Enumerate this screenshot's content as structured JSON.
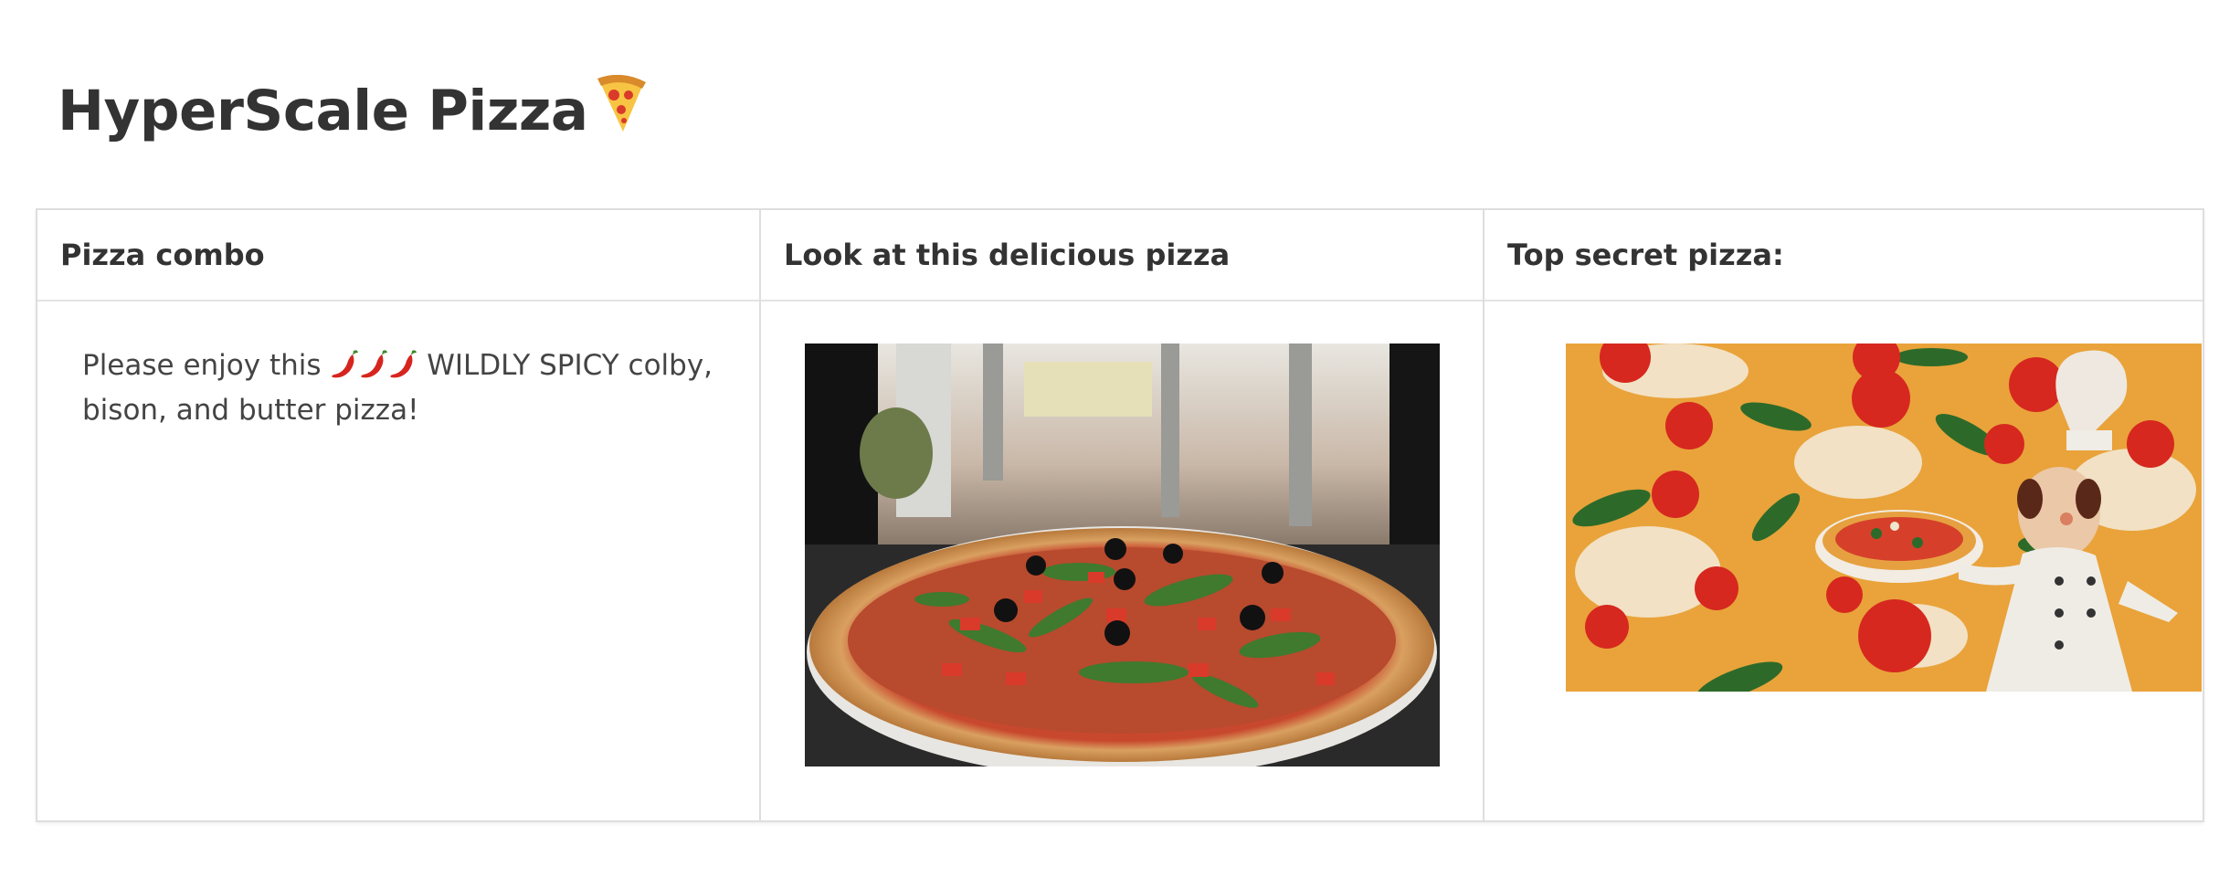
{
  "page": {
    "title": "HyperScale Pizza",
    "title_icon": "pizza-slice-icon"
  },
  "columns": [
    {
      "header": "Pizza combo",
      "text_before": "Please enjoy this",
      "text_icons": [
        "chili-pepper-icon",
        "chili-pepper-icon",
        "chili-pepper-icon"
      ],
      "text_after": "WILDLY SPICY colby, bison, and butter pizza!"
    },
    {
      "header": "Look at this delicious pizza",
      "image": "pizza-photo-arugula-olives"
    },
    {
      "header": "Top secret pizza:",
      "image": "pizza-photo-chef-figurine"
    }
  ],
  "colors": {
    "text": "#333333",
    "border": "#dedede",
    "background": "#ffffff"
  }
}
